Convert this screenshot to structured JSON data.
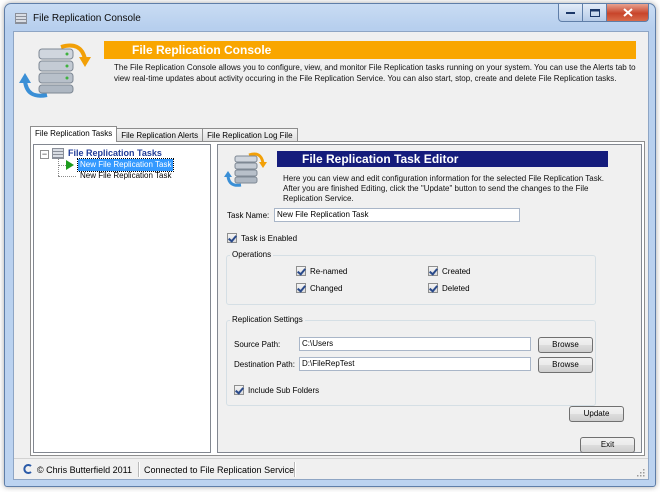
{
  "window": {
    "title": "File Replication Console"
  },
  "header": {
    "banner": "File Replication Console",
    "description": "The File Replication Console allows you to configure, view, and monitor File Replication tasks running on your system.  You can use the Alerts tab to view real-time updates about activity occuring in the File Replication Service.  You can also start, stop, create and delete File Replication tasks."
  },
  "tabs": [
    {
      "label": "File Replication Tasks",
      "active": true
    },
    {
      "label": "File Replication Alerts",
      "active": false
    },
    {
      "label": "File Replication Log File",
      "active": false
    }
  ],
  "tree": {
    "root": "File Replication Tasks",
    "items": [
      {
        "label": "New File Replication Task",
        "selected": true
      },
      {
        "label": "New File Replication Task",
        "selected": false
      }
    ]
  },
  "editor": {
    "banner": "File Replication Task Editor",
    "description": "Here you can view and edit configuration information for the selected File Replication Task.  After you are finished Editing, click the \"Update\" button to send the changes to the File Replication Service.",
    "task_name_label": "Task Name:",
    "task_name_value": "New File Replication Task",
    "task_enabled_label": "Task is Enabled",
    "operations": {
      "title": "Operations",
      "renamed": "Re-named",
      "created": "Created",
      "changed": "Changed",
      "deleted": "Deleted"
    },
    "replication": {
      "title": "Replication Settings",
      "source_label": "Source Path:",
      "source_value": "C:\\Users",
      "dest_label": "Destination Path:",
      "dest_value": "D:\\FileRepTest",
      "browse": "Browse",
      "subfolders": "Include Sub Folders"
    },
    "update": "Update"
  },
  "exit": "Exit",
  "status": {
    "copyright": "© Chris Butterfield 2011",
    "connection": "Connected to File Replication Service"
  },
  "colors": {
    "header_banner": "#f9a600",
    "editor_banner": "#151c7c",
    "selection": "#3399ff"
  }
}
